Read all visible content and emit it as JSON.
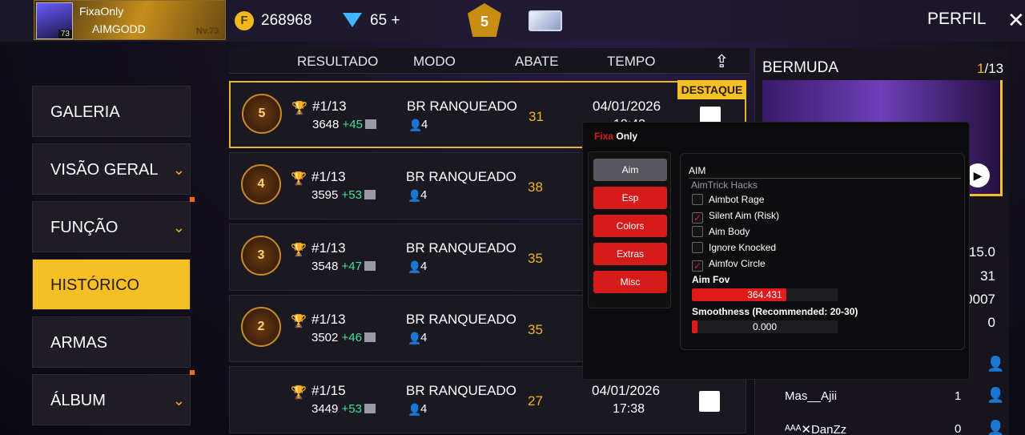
{
  "header": {
    "player_name": "FixaOnly",
    "clan": "AIMGODD",
    "avatar_level": "73",
    "level_tag": "Nv.73",
    "coins": "268968",
    "gems": "65",
    "gems_plus": "+",
    "rank": "5",
    "perfil": "PERFIL",
    "close": "✕"
  },
  "sidebar": {
    "items": [
      {
        "label": "GALERIA",
        "chevron": false,
        "dot": false,
        "active": false
      },
      {
        "label": "VISÃO GERAL",
        "chevron": true,
        "dot": false,
        "active": false
      },
      {
        "label": "FUNÇÃO",
        "chevron": true,
        "dot": true,
        "active": false
      },
      {
        "label": "HISTÓRICO",
        "chevron": false,
        "dot": false,
        "active": true
      },
      {
        "label": "ARMAS",
        "chevron": false,
        "dot": false,
        "active": false
      },
      {
        "label": "ÁLBUM",
        "chevron": true,
        "dot": true,
        "active": false
      }
    ]
  },
  "table": {
    "headers": {
      "resultado": "RESULTADO",
      "modo": "MODO",
      "abate": "ABATE",
      "tempo": "TEMPO"
    },
    "highlight_label": "DESTAQUE",
    "rows": [
      {
        "rank": "5",
        "place": "#1/13",
        "score": "3648",
        "diff": "+45",
        "mode": "BR RANQUEADO",
        "party": "4",
        "kills": "31",
        "date": "04/01/2026",
        "time": "18:43"
      },
      {
        "rank": "4",
        "place": "#1/13",
        "score": "3595",
        "diff": "+53",
        "mode": "BR RANQUEADO",
        "party": "4",
        "kills": "38",
        "date": "",
        "time": ""
      },
      {
        "rank": "3",
        "place": "#1/13",
        "score": "3548",
        "diff": "+47",
        "mode": "BR RANQUEADO",
        "party": "4",
        "kills": "35",
        "date": "",
        "time": ""
      },
      {
        "rank": "2",
        "place": "#1/13",
        "score": "3502",
        "diff": "+46",
        "mode": "BR RANQUEADO",
        "party": "4",
        "kills": "35",
        "date": "",
        "time": ""
      },
      {
        "rank": "",
        "place": "#1/15",
        "score": "3449",
        "diff": "+53",
        "mode": "BR RANQUEADO",
        "party": "4",
        "kills": "27",
        "date": "04/01/2026",
        "time": "17:38"
      }
    ]
  },
  "right_panel": {
    "map": "BERMUDA",
    "page_current": "1",
    "page_total": "/13",
    "stats": [
      "15.0",
      "31",
      "0007",
      "0"
    ],
    "players": [
      {
        "name": "Mas__Ajii",
        "count": "1"
      },
      {
        "name": "ᴬᴬᴬ✕DanZz",
        "count": "0"
      }
    ]
  },
  "mod_menu": {
    "title_red": "Fixa",
    "title_white": "Only",
    "tabs": [
      "Aim",
      "Esp",
      "Colors",
      "Extras",
      "Misc"
    ],
    "selected_tab": "Aim",
    "section_title": "AIM",
    "section_subtitle": "AimTrick Hacks",
    "options": [
      {
        "label": "Aimbot Rage",
        "checked": false
      },
      {
        "label": "Silent Aim (Risk)",
        "checked": true
      },
      {
        "label": "Aim Body",
        "checked": false
      },
      {
        "label": "Ignore Knocked",
        "checked": false
      },
      {
        "label": "Aimfov Circle",
        "checked": true
      }
    ],
    "sliders": [
      {
        "label": "Aim Fov",
        "value": "364.431",
        "fill": 0.65
      },
      {
        "label": "Smoothness (Recommended: 20-30)",
        "value": "0.000",
        "fill": 0.04
      }
    ],
    "accent": "#e01b1b"
  }
}
